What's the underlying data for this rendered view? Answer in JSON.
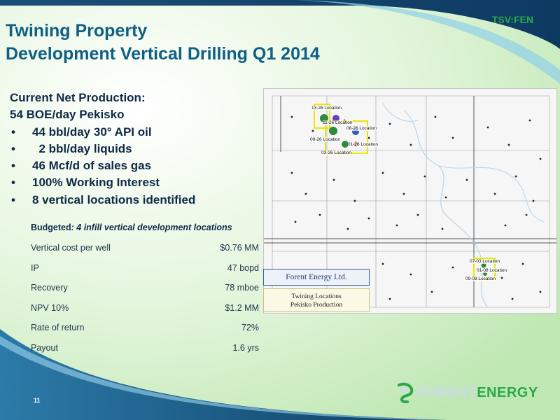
{
  "header": {
    "ticker": "TSV:FEN",
    "title_line1": "Twining Property",
    "title_line2": "Development Vertical Drilling Q1 2014"
  },
  "production": {
    "heading": "Current Net Production:",
    "subheading": "54 BOE/day Pekisko",
    "bullet_glyph": "•",
    "bullets": [
      "44 bbl/day 30° API oil",
      "  2 bbl/day liquids",
      "46 Mcf/d of sales gas",
      "100% Working Interest",
      "8 vertical locations identified"
    ]
  },
  "budget": {
    "title_prefix": "Budgeted",
    "title_rest": ": 4 infill vertical development locations",
    "rows": [
      {
        "label": "Vertical cost per well",
        "value": "$0.76 MM"
      },
      {
        "label": "IP",
        "value": "47 bopd"
      },
      {
        "label": "Recovery",
        "value": "78 mboe"
      },
      {
        "label": "NPV 10%",
        "value": "$1.2 MM"
      },
      {
        "label": "Rate of return",
        "value": "72%"
      },
      {
        "label": "Payout",
        "value": "1.6 yrs"
      }
    ]
  },
  "map": {
    "legend_company": "Forent Energy Ltd.",
    "legend_line1": "Twining Locations",
    "legend_line2": "Pekisko Production",
    "locations": [
      "13-26 Location",
      "11-26 Location",
      "08-26 Location",
      "09-26 Location",
      "01-26 Location",
      "03-26 Location",
      "07-03 Location",
      "01-08 Location",
      "09-08 Location"
    ]
  },
  "footer": {
    "page_number": "11",
    "logo_part1": "FORENT",
    "logo_part2": "ENERGY"
  },
  "colors": {
    "title": "#0f5f84",
    "accent_green": "#2aa84a",
    "text_dark": "#0e2a45"
  }
}
